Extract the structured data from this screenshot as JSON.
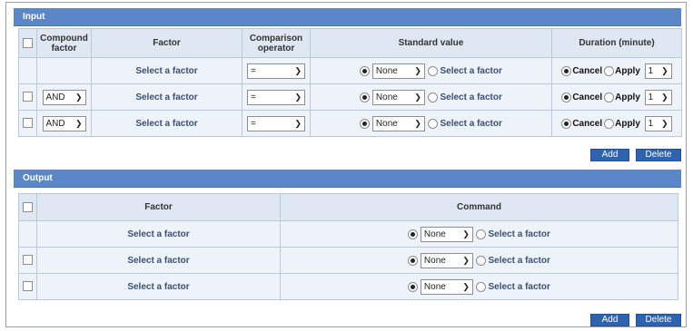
{
  "input": {
    "title": "Input",
    "headers": {
      "compound": "Compound factor",
      "factor": "Factor",
      "operator": "Comparison operator",
      "standard": "Standard value",
      "duration": "Duration (minute)"
    },
    "rows": [
      {
        "compound": "",
        "factor": "Select a factor",
        "operator": "=",
        "std_select": "None",
        "std_link": "Select a factor",
        "cancel": "Cancel",
        "apply": "Apply",
        "minutes": "1"
      },
      {
        "compound": "AND",
        "factor": "Select a factor",
        "operator": "=",
        "std_select": "None",
        "std_link": "Select a factor",
        "cancel": "Cancel",
        "apply": "Apply",
        "minutes": "1"
      },
      {
        "compound": "AND",
        "factor": "Select a factor",
        "operator": "=",
        "std_select": "None",
        "std_link": "Select a factor",
        "cancel": "Cancel",
        "apply": "Apply",
        "minutes": "1"
      }
    ],
    "add_label": "Add",
    "delete_label": "Delete"
  },
  "output": {
    "title": "Output",
    "headers": {
      "factor": "Factor",
      "command": "Command"
    },
    "rows": [
      {
        "factor": "Select a factor",
        "cmd_select": "None",
        "cmd_link": "Select a factor"
      },
      {
        "factor": "Select a factor",
        "cmd_select": "None",
        "cmd_link": "Select a factor"
      },
      {
        "factor": "Select a factor",
        "cmd_select": "None",
        "cmd_link": "Select a factor"
      }
    ],
    "add_label": "Add",
    "delete_label": "Delete"
  },
  "icons": {
    "dropdown": "chevron-down-icon",
    "radio_selected": "radio-selected-icon"
  },
  "colors": {
    "section_bar": "#5b87c9",
    "button": "#2e63b0",
    "cell_bg": "#eef3fa",
    "header_bg": "#dfe7f3"
  }
}
